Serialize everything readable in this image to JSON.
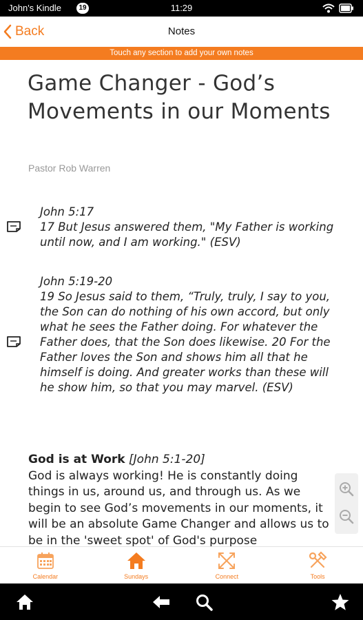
{
  "status_bar": {
    "owner": "John's Kindle",
    "notification_count": "19",
    "time": "11:29",
    "icons": [
      "wifi-icon",
      "battery-icon"
    ]
  },
  "title_bar": {
    "back_label": "Back",
    "title": "Notes"
  },
  "banner": "Touch any section to add your own notes",
  "sermon": {
    "title": "Game Changer - God’s Movements in our Moments",
    "pastor": "Pastor Rob Warren"
  },
  "scriptures": [
    {
      "ref": "John 5:17",
      "text": "17 But Jesus answered them, \"My Father is working until now, and I am working.\" (ESV)"
    },
    {
      "ref": "John 5:19-20",
      "text": "19 So Jesus said to them, “Truly, truly, I say to you, the Son can do nothing of his own accord, but only what he sees the Father doing. For whatever the Father does, that the Son does likewise. 20 For the Father loves the Son and shows him all that he himself is doing. And greater works than these will he show him, so that you may marvel. (ESV)"
    }
  ],
  "section": {
    "heading": "God is at Work",
    "reference": "[John 5:1-20]",
    "body": "God is always working! He is constantly doing things in us, around us, and through us. As we begin to see God’s movements in our moments, it will be an absolute Game Changer and allows us to be in the 'sweet spot' of God's purpose"
  },
  "tabs": [
    {
      "label": "Calendar",
      "icon": "calendar-icon"
    },
    {
      "label": "Sundays",
      "icon": "home-icon"
    },
    {
      "label": "Connect",
      "icon": "connect-icon"
    },
    {
      "label": "Tools",
      "icon": "tools-icon"
    }
  ],
  "colors": {
    "accent": "#f47c20",
    "status_bar": "#000000",
    "nav_bar": "#000000"
  }
}
